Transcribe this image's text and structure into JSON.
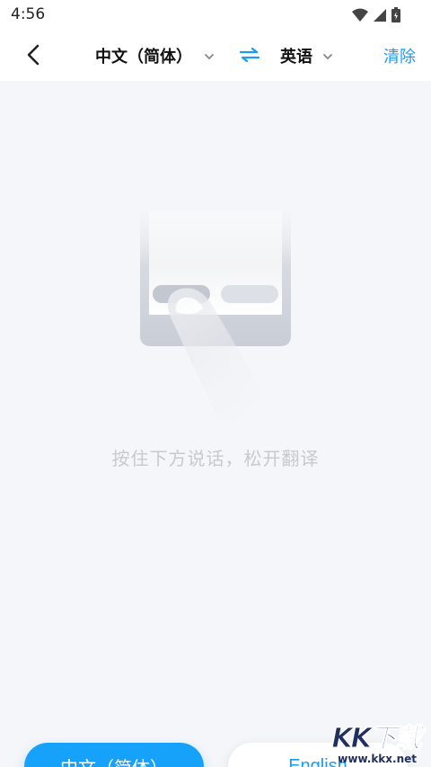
{
  "status": {
    "time": "4:56"
  },
  "header": {
    "source_language": "中文（简体）",
    "target_language": "英语",
    "clear_label": "清除"
  },
  "main": {
    "hint": "按住下方说话，松开翻译"
  },
  "buttons": {
    "source_label": "中文（简体）",
    "target_label": "English"
  },
  "watermark": {
    "logo": "KK下载",
    "url": "www.kkx.net"
  },
  "colors": {
    "accent": "#16a1fb",
    "hint_text": "#c8c9cd",
    "background": "#f5f6f9"
  }
}
